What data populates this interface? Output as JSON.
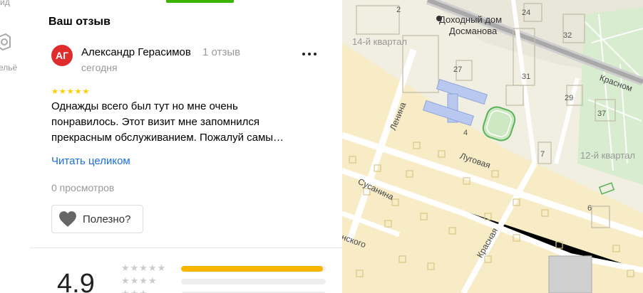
{
  "rail": {
    "item1": "ид",
    "item2": "ельё"
  },
  "review": {
    "section_title": "Ваш отзыв",
    "avatar_initials": "АГ",
    "author": "Александр Герасимов",
    "review_count": "1 отзыв",
    "date": "сегодня",
    "rating_stars": 5,
    "text_line1": "Однажды всего был тут но мне очень",
    "text_line2": "понравилось. Этот визит мне запомнился",
    "text_line3": "прекрасным обслуживанием. Пожалуй самы…",
    "read_more": "Читать целиком",
    "views": "0 просмотров",
    "useful_label": "Полезно?"
  },
  "rating": {
    "value": "4.9",
    "distribution": [
      0.98,
      0.0,
      0.0
    ]
  },
  "map": {
    "labels": {
      "building": "Доходный дом",
      "building2": "Досманова",
      "kvartal14": "14-й квартал",
      "kvartal12": "12-й квартал",
      "lenina": "Ленина",
      "lugovaya": "Луговая",
      "susanina": "Сусанина",
      "krasnaya": "Красная",
      "krasnom": "Красном",
      "nskogo": "нского"
    },
    "numbers": {
      "n2": "2",
      "n24": "24",
      "n32": "32",
      "n27": "27",
      "n31": "31",
      "n29": "29",
      "n37": "37",
      "n4": "4",
      "n7": "7",
      "n6": "6"
    }
  },
  "colors": {
    "accent_green": "#3bb300",
    "avatar_red": "#e02c2c",
    "link_blue": "#1a6fd8",
    "star_yellow": "#ffcc00",
    "bar_yellow": "#f7b500"
  }
}
